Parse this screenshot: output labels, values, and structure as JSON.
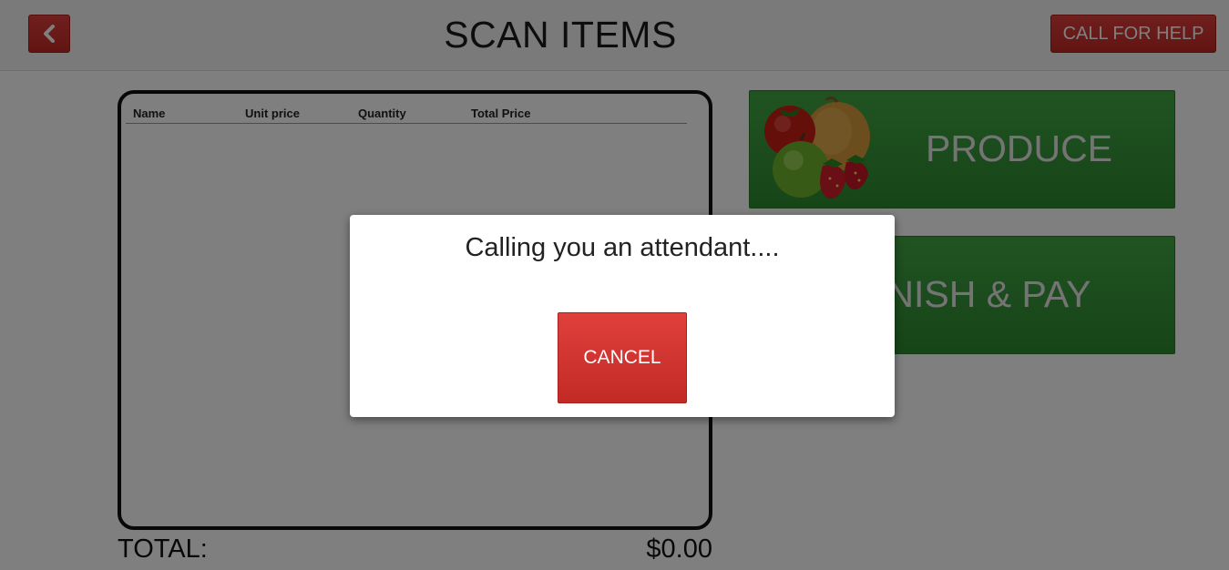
{
  "header": {
    "title": "SCAN ITEMS",
    "back_icon": "chevron-left-icon",
    "help_label": "CALL FOR HELP"
  },
  "cart": {
    "columns": [
      "Name",
      "Unit price",
      "Quantity",
      "Total Price"
    ],
    "rows": [],
    "total_label": "TOTAL:",
    "total_value": "$0.00"
  },
  "tiles": {
    "produce_label": "PRODUCE",
    "produce_icon": "produce-image",
    "finish_label": "FINISH & PAY"
  },
  "modal": {
    "message": "Calling you an attendant....",
    "cancel_label": "CANCEL"
  },
  "colors": {
    "accent_red": "#d9342f",
    "tile_green": "#3a9a3c",
    "overlay": "rgba(0,0,0,0.5)"
  }
}
